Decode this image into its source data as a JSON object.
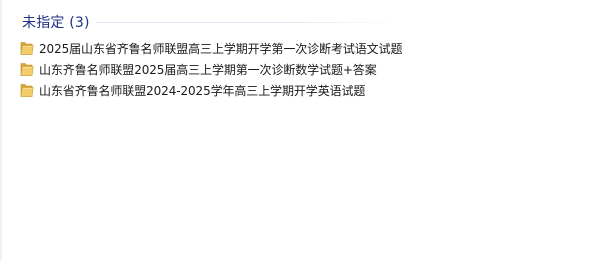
{
  "group": {
    "title": "未指定 (3)"
  },
  "files": [
    {
      "name": "2025届山东省齐鲁名师联盟高三上学期开学第一次诊断考试语文试题",
      "icon": "folder-icon"
    },
    {
      "name": "山东齐鲁名师联盟2025届高三上学期第一次诊断数学试题+答案",
      "icon": "folder-icon"
    },
    {
      "name": "山东省齐鲁名师联盟2024-2025学年高三上学期开学英语试题",
      "icon": "folder-icon"
    }
  ],
  "colors": {
    "group_title": "#1e3287",
    "folder_body": "#e8b946",
    "folder_front": "#f5d071",
    "background": "#ffffff"
  }
}
